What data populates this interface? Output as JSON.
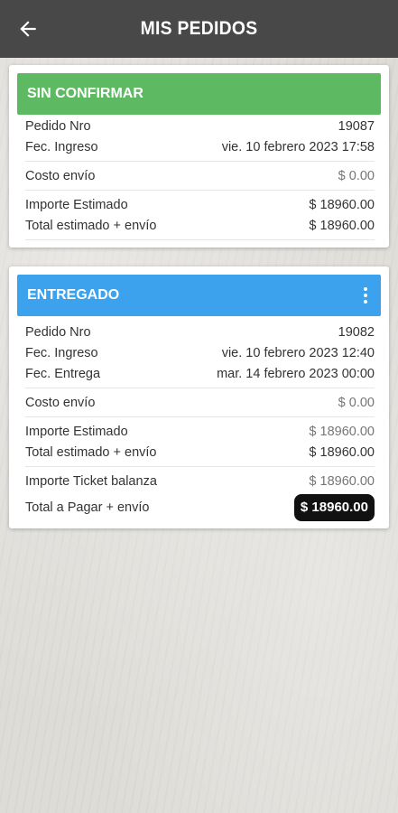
{
  "appbar": {
    "title": "MIS PEDIDOS"
  },
  "orders": [
    {
      "status": "SIN CONFIRMAR",
      "status_color": "#5dba62",
      "pedido_label": "Pedido Nro",
      "pedido": "19087",
      "ingreso_label": "Fec. Ingreso",
      "ingreso": "vie. 10 febrero 2023 17:58",
      "envio_label": "Costo envío",
      "envio": "$ 0.00",
      "importe_label": "Importe Estimado",
      "importe": "$ 18960.00",
      "total_label": "Total estimado + envío",
      "total": "$ 18960.00"
    },
    {
      "status": "ENTREGADO",
      "status_color": "#3ca2ee",
      "pedido_label": "Pedido Nro",
      "pedido": "19082",
      "ingreso_label": "Fec. Ingreso",
      "ingreso": "vie. 10 febrero 2023 12:40",
      "entrega_label": "Fec. Entrega",
      "entrega": "mar. 14 febrero 2023 00:00",
      "envio_label": "Costo envío",
      "envio": "$ 0.00",
      "importe_label": "Importe Estimado",
      "importe": "$ 18960.00",
      "total_label": "Total estimado + envío",
      "total": "$ 18960.00",
      "ticket_label": "Importe Ticket balanza",
      "ticket": "$ 18960.00",
      "pagar_label": "Total a Pagar + envío",
      "pagar": "$ 18960.00"
    }
  ]
}
